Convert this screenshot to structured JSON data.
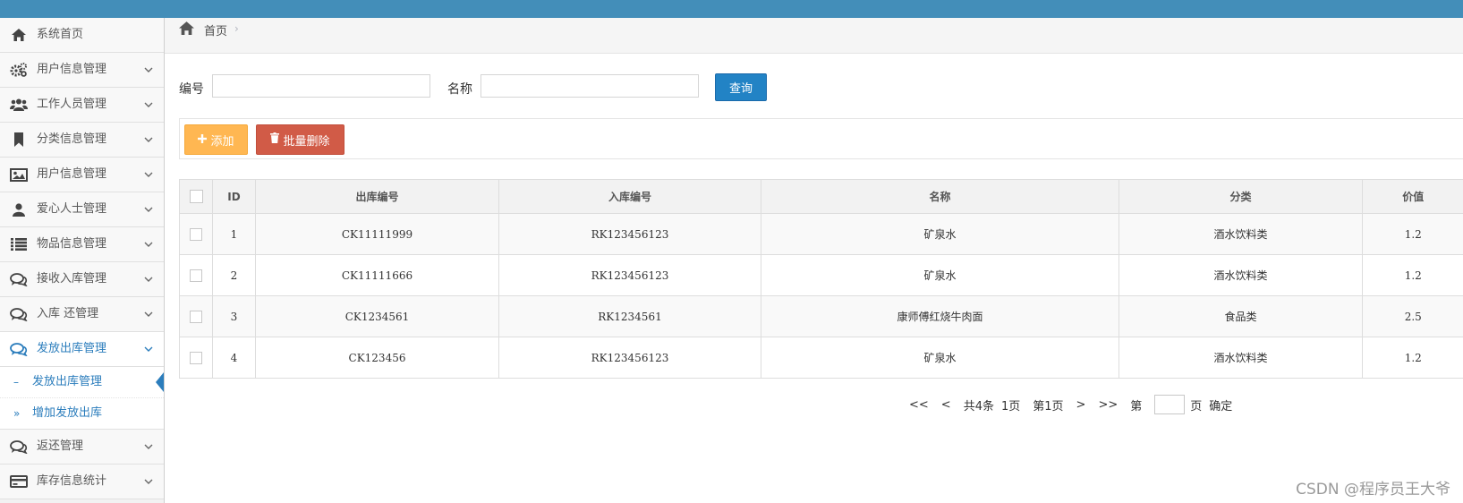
{
  "colors": {
    "topbar": "#438eb9",
    "accent": "#2b7dbc",
    "query_button": "#2283c5",
    "add_button": "#ffb752",
    "delete_button": "#d15b47"
  },
  "sidebar": {
    "items": [
      {
        "label": "系统首页",
        "icon": "home-icon"
      },
      {
        "label": "用户信息管理",
        "icon": "gears-icon"
      },
      {
        "label": "工作人员管理",
        "icon": "users-icon"
      },
      {
        "label": "分类信息管理",
        "icon": "bookmark-icon"
      },
      {
        "label": "用户信息管理",
        "icon": "picture-icon"
      },
      {
        "label": "爱心人士管理",
        "icon": "user-icon"
      },
      {
        "label": "物品信息管理",
        "icon": "list-icon"
      },
      {
        "label": "接收入库管理",
        "icon": "comments-icon"
      },
      {
        "label": "入库 还管理",
        "icon": "comments-icon"
      },
      {
        "label": "发放出库管理",
        "icon": "comments-icon"
      },
      {
        "label": "返还管理",
        "icon": "comments-icon"
      },
      {
        "label": "库存信息统计",
        "icon": "credit-card-icon"
      }
    ],
    "submenu": [
      {
        "label": "发放出库管理"
      },
      {
        "label": "增加发放出库"
      }
    ]
  },
  "breadcrumb": {
    "home": "首页",
    "separator": "›"
  },
  "search": {
    "code_label": "编号",
    "code_value": "",
    "name_label": "名称",
    "name_value": "",
    "query_label": "查询"
  },
  "toolbar": {
    "add_label": "添加",
    "batch_delete_label": "批量删除"
  },
  "table": {
    "headers": [
      "ID",
      "出库编号",
      "入库编号",
      "名称",
      "分类",
      "价值"
    ],
    "rows": [
      [
        "1",
        "CK11111999",
        "RK123456123",
        "矿泉水",
        "酒水饮料类",
        "1.2"
      ],
      [
        "2",
        "CK11111666",
        "RK123456123",
        "矿泉水",
        "酒水饮料类",
        "1.2"
      ],
      [
        "3",
        "CK1234561",
        "RK1234561",
        "康师傅红烧牛肉面",
        "食品类",
        "2.5"
      ],
      [
        "4",
        "CK123456",
        "RK123456123",
        "矿泉水",
        "酒水饮料类",
        "1.2"
      ]
    ]
  },
  "pagination": {
    "first": "<<",
    "prev": "<",
    "total": "共4条",
    "pages": "1页",
    "current": "第1页",
    "next": ">",
    "last": ">>",
    "goto_prefix": "第",
    "goto_value": "",
    "goto_suffix": "页",
    "confirm": "确定"
  },
  "watermark": "CSDN @程序员王大爷"
}
